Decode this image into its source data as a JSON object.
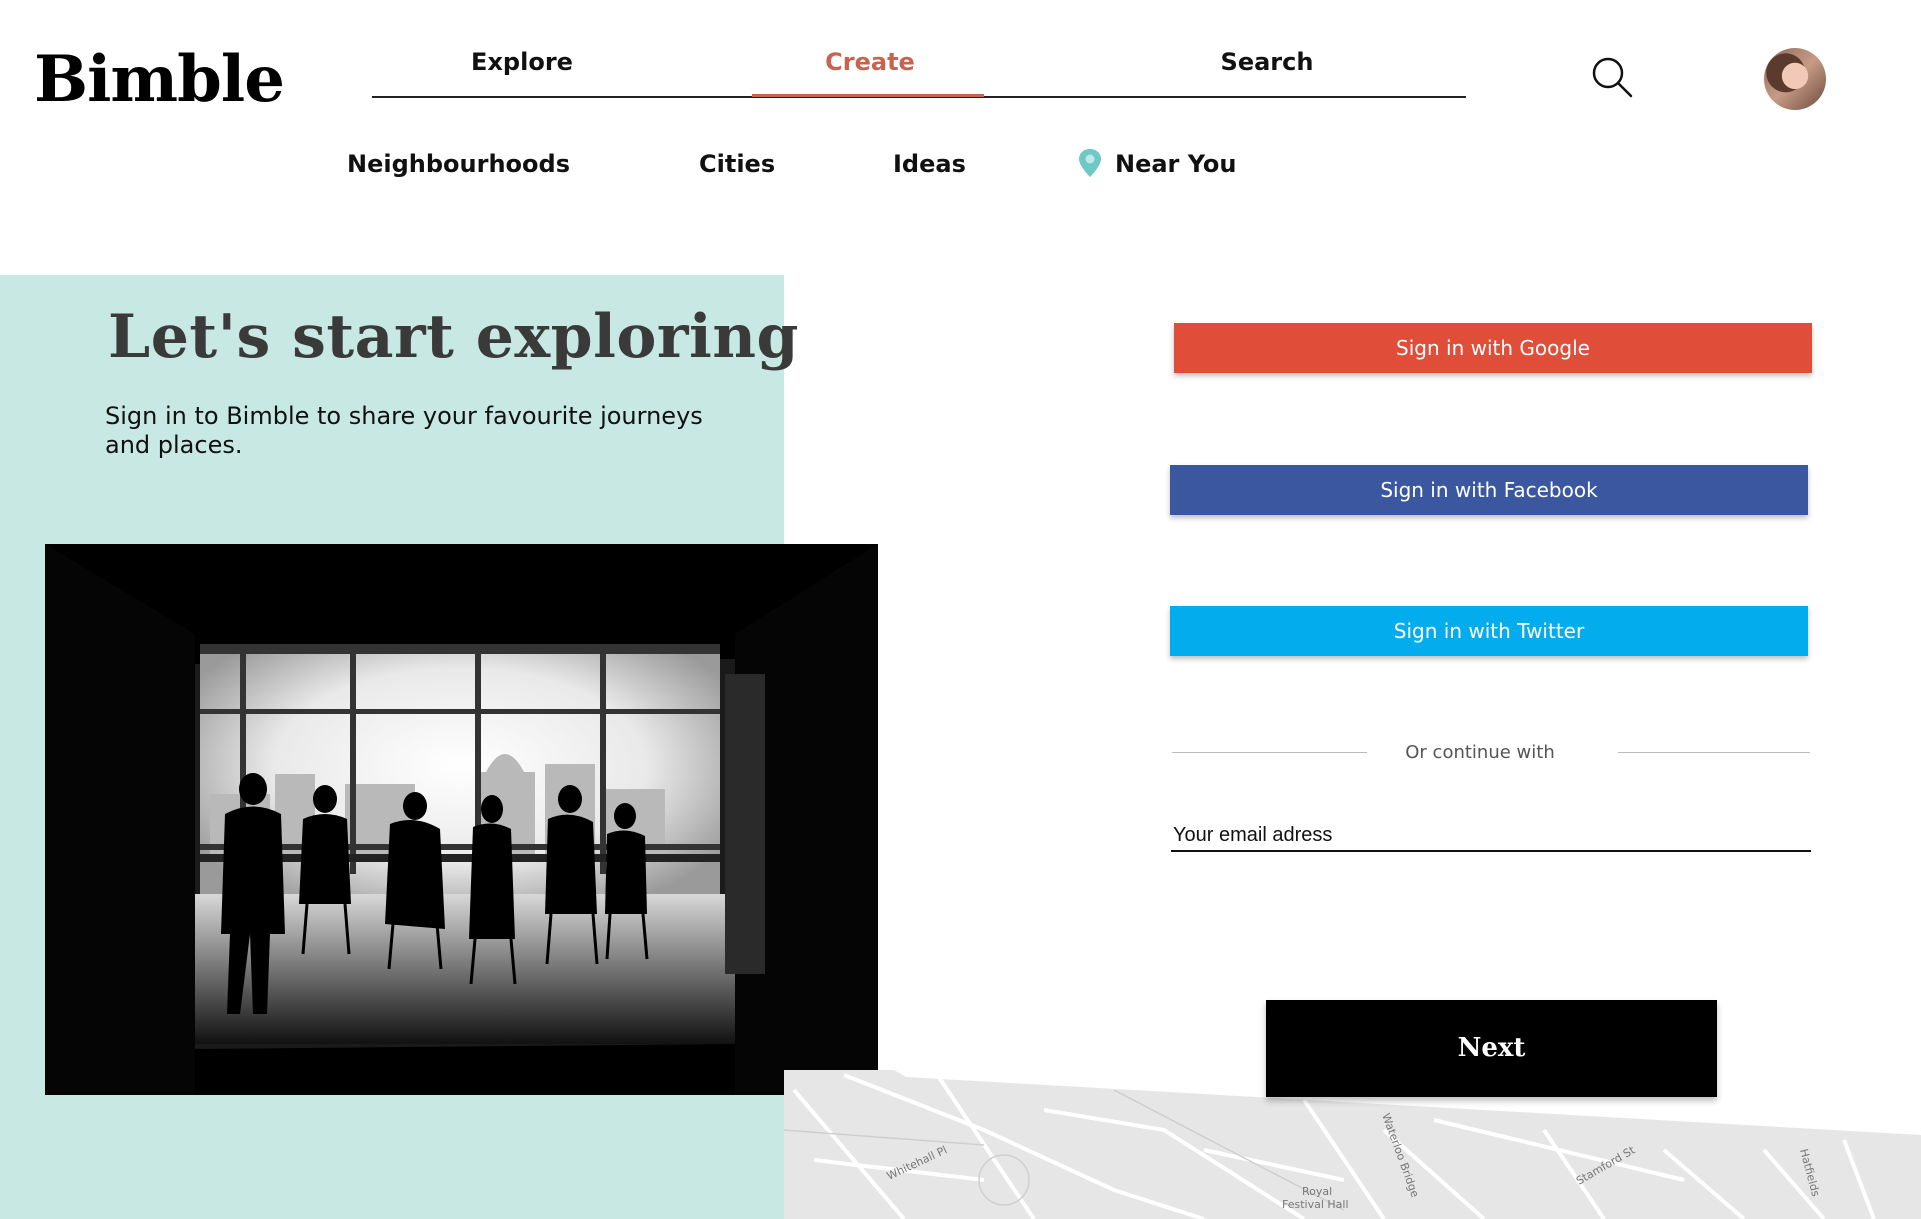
{
  "brand": {
    "logo": "Bimble"
  },
  "nav": {
    "tabs": [
      {
        "label": "Explore"
      },
      {
        "label": "Create",
        "active": true
      },
      {
        "label": "Search"
      }
    ],
    "search_icon": "search-icon",
    "avatar_icon": "avatar"
  },
  "subnav": {
    "items": [
      {
        "label": "Neighbourhoods"
      },
      {
        "label": "Cities"
      },
      {
        "label": "Ideas"
      },
      {
        "label": "Near You",
        "icon": "map-pin-icon"
      }
    ]
  },
  "hero": {
    "title": "Let's start exploring",
    "subtitle": "Sign in to Bimble to share your favourite journeys and places."
  },
  "signin": {
    "google": "Sign in with Google",
    "facebook": "Sign in with Facebook",
    "twitter": "Sign in with Twitter",
    "or_text": "Or continue with",
    "email_placeholder": "Your email adress",
    "next": "Next"
  },
  "map": {
    "labels": [
      "Whitehall Pl",
      "Waterloo Bridge",
      "Royal",
      "Festival Hall",
      "Stamford St",
      "Hatfields"
    ]
  },
  "colors": {
    "accent": "#c8634f",
    "panel": "#c7e8e3",
    "google": "#e04e39",
    "facebook": "#3b57a0",
    "twitter": "#03aded",
    "pin": "#6fc7c6"
  }
}
